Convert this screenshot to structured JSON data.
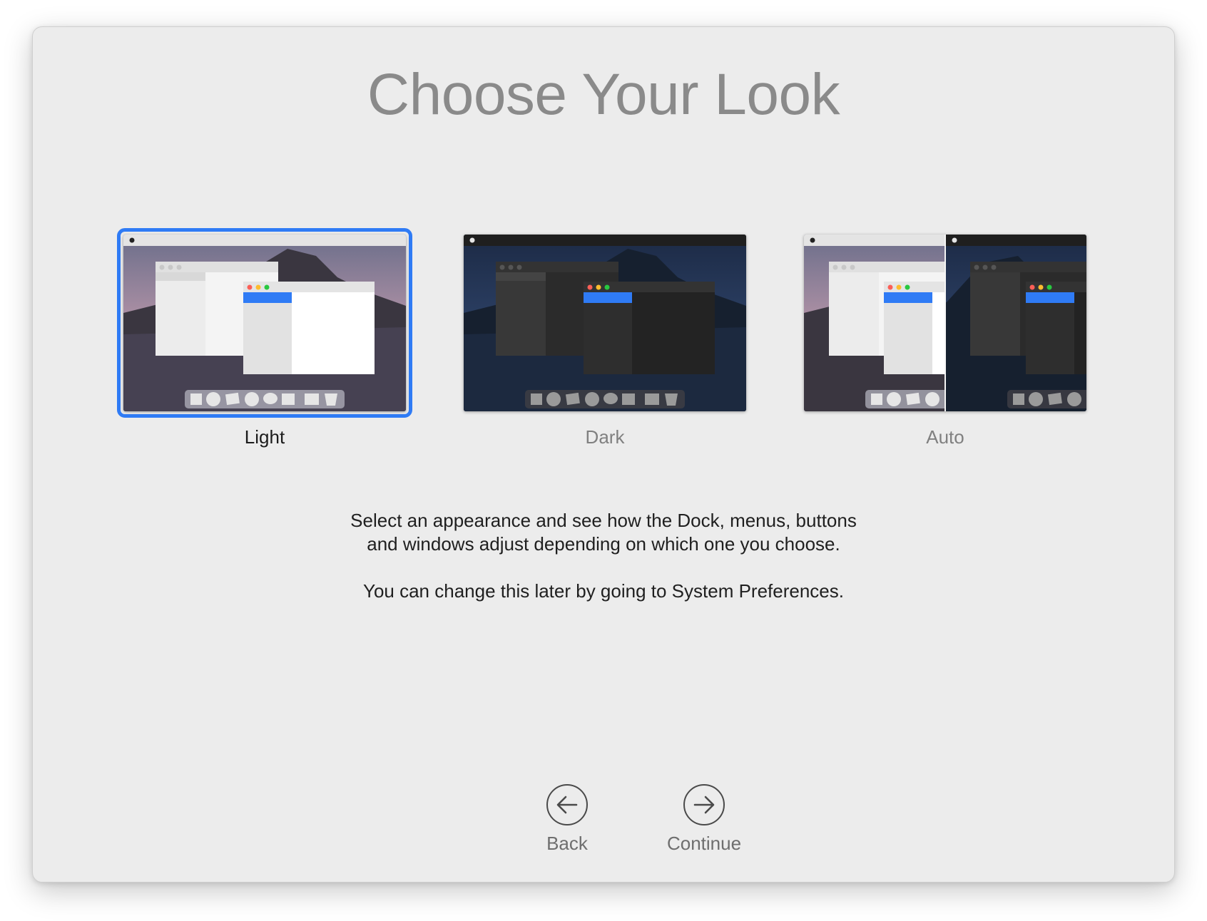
{
  "title": "Choose Your Look",
  "options": [
    {
      "label": "Light",
      "selected": true
    },
    {
      "label": "Dark",
      "selected": false
    },
    {
      "label": "Auto",
      "selected": false
    }
  ],
  "description": {
    "line1": "Select an appearance and see how the Dock, menus, buttons",
    "line2": "and windows adjust depending on which one you choose.",
    "line3": "You can change this later by going to System Preferences."
  },
  "nav": {
    "back_label": "Back",
    "continue_label": "Continue",
    "back_icon": "arrow-left-circle-icon",
    "continue_icon": "arrow-right-circle-icon"
  },
  "colors": {
    "accent": "#2f7bf5",
    "background": "#ececec",
    "title": "#8a8a8a"
  }
}
